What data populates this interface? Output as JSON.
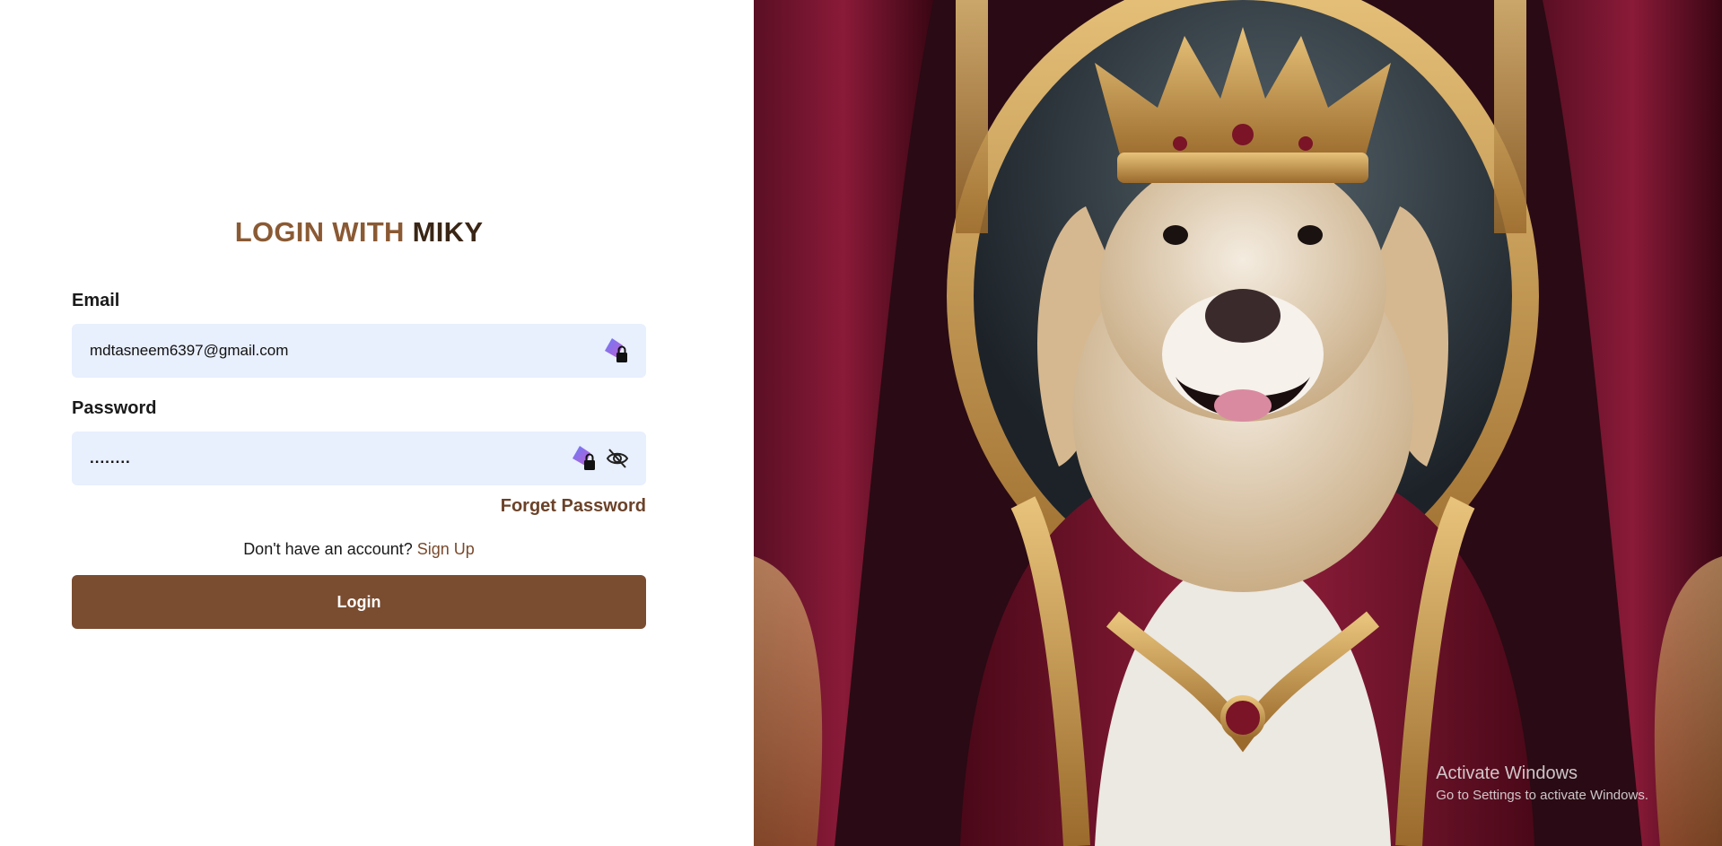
{
  "login": {
    "title_part1": "LOGIN WITH ",
    "title_part2": "MIKY",
    "email_label": "Email",
    "email_value": "mdtasneem6397@gmail.com",
    "password_label": "Password",
    "password_value": "........",
    "forget_password": "Forget Password",
    "signup_prompt": "Don't have an account? ",
    "signup_link": "Sign Up",
    "login_button": "Login"
  },
  "hero_image": {
    "subject": "golden retriever dog wearing a golden crown and red royal robe"
  },
  "watermark": {
    "line1": "Activate Windows",
    "line2": "Go to Settings to activate Windows."
  },
  "colors": {
    "accent_brown": "#8a5a34",
    "button_brown": "#7a4c30",
    "field_bg": "#e8effd"
  },
  "icons": [
    "password-manager-icon",
    "eye-off-icon"
  ]
}
